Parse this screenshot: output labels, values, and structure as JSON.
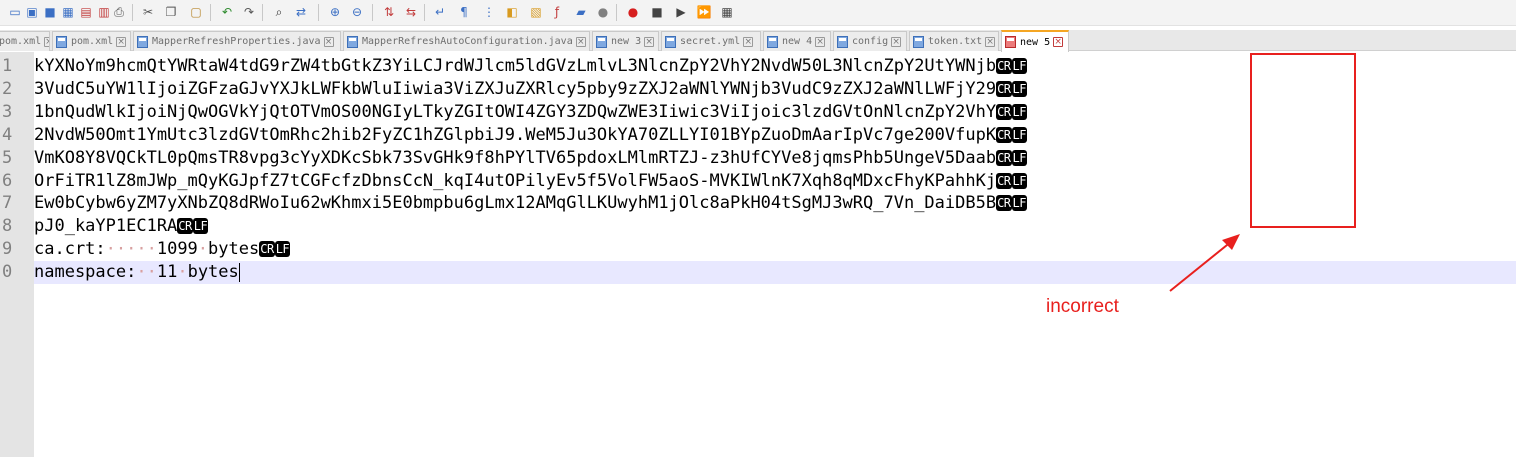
{
  "toolbar": {
    "buttons": [
      {
        "icon": "new-file-icon",
        "glyph": "▭",
        "color": "#3b6fc4"
      },
      {
        "icon": "open-file-icon",
        "glyph": "▣",
        "color": "#3b6fc4"
      },
      {
        "icon": "save-icon",
        "glyph": "■",
        "color": "#3b6fc4"
      },
      {
        "icon": "save-all-icon",
        "glyph": "▦",
        "color": "#3b6fc4"
      },
      {
        "icon": "close-icon",
        "glyph": "▤",
        "color": "#c23b3b"
      },
      {
        "icon": "close-all-icon",
        "glyph": "▥",
        "color": "#c23b3b"
      },
      {
        "icon": "print-icon",
        "glyph": "⎙",
        "color": "#555555"
      },
      {
        "icon": "cut-icon",
        "glyph": "✂",
        "color": "#555555"
      },
      {
        "icon": "copy-icon",
        "glyph": "❐",
        "color": "#555555"
      },
      {
        "icon": "paste-icon",
        "glyph": "▢",
        "color": "#b8862b"
      },
      {
        "icon": "undo-icon",
        "glyph": "↶",
        "color": "#2e8b2e"
      },
      {
        "icon": "redo-icon",
        "glyph": "↷",
        "color": "#555555"
      },
      {
        "icon": "find-icon",
        "glyph": "⌕",
        "color": "#333333"
      },
      {
        "icon": "replace-icon",
        "glyph": "⇄",
        "color": "#3b6fc4"
      },
      {
        "icon": "zoom-in-icon",
        "glyph": "⊕",
        "color": "#3b6fc4"
      },
      {
        "icon": "zoom-out-icon",
        "glyph": "⊖",
        "color": "#3b6fc4"
      },
      {
        "icon": "sync-vertical-icon",
        "glyph": "⇅",
        "color": "#c23b3b"
      },
      {
        "icon": "sync-horizontal-icon",
        "glyph": "⇆",
        "color": "#c23b3b"
      },
      {
        "icon": "word-wrap-icon",
        "glyph": "↵",
        "color": "#3b6fc4"
      },
      {
        "icon": "show-all-characters-icon",
        "glyph": "¶",
        "color": "#3b6fc4"
      },
      {
        "icon": "indent-guide-icon",
        "glyph": "⋮",
        "color": "#3b6fc4"
      },
      {
        "icon": "user-language-icon",
        "glyph": "◧",
        "color": "#d89a1f"
      },
      {
        "icon": "document-map-icon",
        "glyph": "▧",
        "color": "#d89a1f"
      },
      {
        "icon": "function-list-icon",
        "glyph": "ƒ",
        "color": "#c23b3b"
      },
      {
        "icon": "folder-workspace-icon",
        "glyph": "▰",
        "color": "#3b6fc4"
      },
      {
        "icon": "monitoring-icon",
        "glyph": "●",
        "color": "#808080"
      },
      {
        "icon": "record-macro-icon",
        "glyph": "●",
        "color": "#d61e1e"
      },
      {
        "icon": "stop-macro-icon",
        "glyph": "■",
        "color": "#444444"
      },
      {
        "icon": "play-macro-icon",
        "glyph": "▶",
        "color": "#444444"
      },
      {
        "icon": "run-macro-multiple-icon",
        "glyph": "⏩",
        "color": "#3b6fc4"
      },
      {
        "icon": "save-macro-icon",
        "glyph": "▦",
        "color": "#444444"
      }
    ]
  },
  "tabs": [
    {
      "label": "pom.xml",
      "active": false,
      "modified": false
    },
    {
      "label": "pom.xml",
      "active": false,
      "modified": false
    },
    {
      "label": "MapperRefreshProperties.java",
      "active": false,
      "modified": false
    },
    {
      "label": "MapperRefreshAutoConfiguration.java",
      "active": false,
      "modified": false
    },
    {
      "label": "new 3",
      "active": false,
      "modified": false
    },
    {
      "label": "secret.yml",
      "active": false,
      "modified": false
    },
    {
      "label": "new 4",
      "active": false,
      "modified": false
    },
    {
      "label": "config",
      "active": false,
      "modified": false
    },
    {
      "label": "token.txt",
      "active": false,
      "modified": false
    },
    {
      "label": "new 5",
      "active": true,
      "modified": true
    }
  ],
  "editor": {
    "lines": [
      {
        "num": "1",
        "text": "kYXNoYm9hcmQtYWRtaW4tdG9rZW4tbGtkZ3YiLCJrdWJlcm5ldGVzLmlvL3NlcnZpY2VhY2NvdW50L3NlcnZpY2UtYWNjb",
        "eol": [
          "CR",
          "LF"
        ]
      },
      {
        "num": "2",
        "text": "3VudC5uYW1lIjoiZGFzaGJvYXJkLWFkbWluIiwia3ViZXJuZXRlcy5pby9zZXJ2aWNlYWNjb3VudC9zZXJ2aWNlLWFjY29",
        "eol": [
          "CR",
          "LF"
        ]
      },
      {
        "num": "3",
        "text": "1bnQudWlkIjoiNjQwOGVkYjQtOTVmOS00NGIyLTkyZGItOWI4ZGY3ZDQwZWE3Iiwic3ViIjoic3lzdGVtOnNlcnZpY2VhY",
        "eol": [
          "CR",
          "LF"
        ]
      },
      {
        "num": "4",
        "text": "2NvdW50Omt1YmUtc3lzdGVtOmRhc2hib2FyZC1hZGlpbiJ9.WeM5Ju3OkYA70ZLLYI01BYpZuoDmAarIpVc7ge200VfupK",
        "eol": [
          "CR",
          "LF"
        ]
      },
      {
        "num": "5",
        "text": "VmKO8Y8VQCkTL0pQmsTR8vpg3cYyXDKcSbk73SvGHk9f8hPYlTV65pdoxLMlmRTZJ-z3hUfCYVe8jqmsPhb5UngeV5Daab",
        "eol": [
          "CR",
          "LF"
        ]
      },
      {
        "num": "6",
        "text": "OrFiTR1lZ8mJWp_mQyKGJpfZ7tCGFcfzDbnsCcN_kqI4utOPilyEv5f5VolFW5aoS-MVKIWlnK7Xqh8qMDxcFhyKPahhKj",
        "eol": [
          "CR",
          "LF"
        ]
      },
      {
        "num": "7",
        "text": "Ew0bCybw6yZM7yXNbZQ8dRWoIu62wKhmxi5E0bmpbu6gLmx12AMqGlLKUwyhM1jOlc8aPkH04tSgMJ3wRQ_7Vn_DaiDB5B",
        "eol": [
          "CR",
          "LF"
        ]
      },
      {
        "num": "8",
        "text": "pJ0_kaYP1EC1RA",
        "eol": [
          "CR",
          "LF"
        ]
      },
      {
        "num": "9",
        "segments": [
          "ca.crt:",
          "·····",
          "1099",
          "·",
          "bytes"
        ],
        "eol": [
          "CR",
          "LF"
        ]
      },
      {
        "num": "0",
        "segments": [
          "namespace:",
          "··",
          "11",
          "·",
          "bytes"
        ],
        "eol": [],
        "current": true
      }
    ]
  },
  "annotation": {
    "label": "incorrect",
    "color": "#e8201e"
  }
}
